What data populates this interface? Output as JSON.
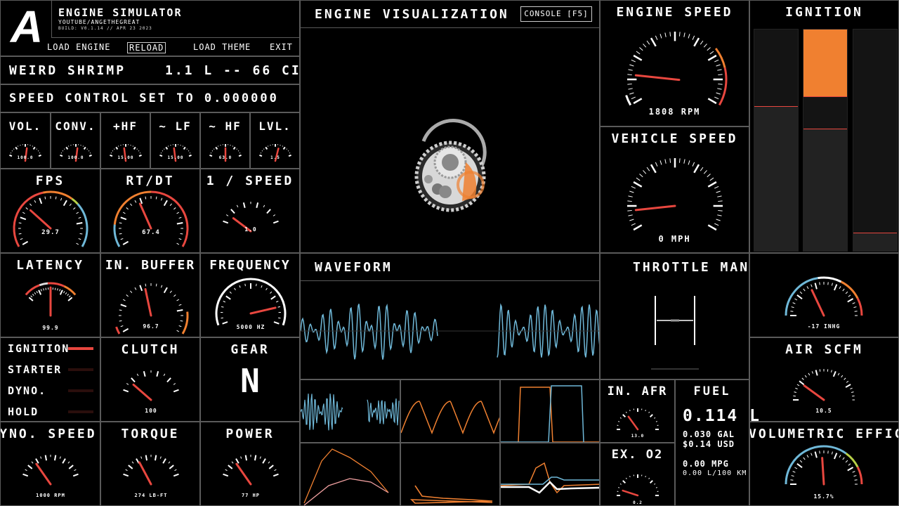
{
  "header": {
    "logo_letter": "A",
    "title": "ENGINE SIMULATOR",
    "subtitle": "YOUTUBE/ANGETHEGREAT",
    "build": "BUILD: V0.1.14 // APR 23 2023",
    "buttons": [
      "LOAD ENGINE",
      "RELOAD",
      "LOAD THEME",
      "EXIT"
    ]
  },
  "engine_name": "WEIRD SHRIMP",
  "engine_displacement": "1.1 L -- 66 CI",
  "speed_control": "SPEED CONTROL SET TO 0.000000",
  "visualization": {
    "title": "ENGINE VISUALIZATION",
    "console_button": "CONSOLE [F5]"
  },
  "colors": {
    "red": "#e8473f",
    "orange": "#f08030",
    "blue": "#6fb8d8",
    "white": "#ffffff",
    "green": "#b8d048"
  },
  "gauges": {
    "vol": {
      "title": "VOL.",
      "value": "100.0"
    },
    "conv": {
      "title": "CONV.",
      "value": "100.0"
    },
    "hf": {
      "title": "+HF",
      "value": "15.00"
    },
    "lf": {
      "title": "~ LF",
      "value": "15.00"
    },
    "hf2": {
      "title": "~ HF",
      "value": "63.0"
    },
    "lvl": {
      "title": "LVL.",
      "value": "1.5"
    },
    "fps": {
      "title": "FPS",
      "value": "29.7"
    },
    "rtdt": {
      "title": "RT/DT",
      "value": "67.4"
    },
    "speed_inv": {
      "title": "1 / SPEED",
      "value": "1.0"
    },
    "latency": {
      "title": "LATENCY",
      "value": "99.9"
    },
    "in_buffer": {
      "title": "IN. BUFFER",
      "value": "96.7"
    },
    "frequency": {
      "title": "FREQUENCY",
      "value": "5000 HZ"
    },
    "engine_speed": {
      "title": "ENGINE SPEED",
      "value": "1808 RPM"
    },
    "vehicle_speed": {
      "title": "VEHICLE SPEED",
      "value": "0 MPH"
    },
    "clutch": {
      "title": "CLUTCH",
      "value": "100"
    },
    "dyno_speed": {
      "title": "DYNO. SPEED",
      "value": "1000 RPM"
    },
    "torque": {
      "title": "TORQUE",
      "value": "274 LB-FT"
    },
    "power": {
      "title": "POWER",
      "value": "77 HP"
    },
    "manifold": {
      "title": "THROTTLE MANIFOLD PRESSURE",
      "value": "-17 INHG"
    },
    "air_scfm": {
      "title": "AIR SCFM",
      "value": "10.5"
    },
    "in_afr": {
      "title": "IN. AFR",
      "value": "13.0"
    },
    "ex_o2": {
      "title": "EX. O2",
      "value": "0.2"
    },
    "vol_eff": {
      "title": "VOLUMETRIC EFFICIENCY",
      "value": "15.7%"
    }
  },
  "ignition_panel": {
    "title": "IGNITION",
    "bar_levels": [
      0.65,
      0.55,
      0.08
    ]
  },
  "status_lights": [
    "IGNITION",
    "STARTER",
    "DYNO.",
    "HOLD"
  ],
  "gear": {
    "title": "GEAR",
    "value": "N"
  },
  "fuel": {
    "title": "FUEL",
    "main": "0.114 L",
    "gal": "0.030 GAL",
    "usd": "$0.14 USD",
    "mpg": "0.00 MPG",
    "l100": "0.00 L/100 KM"
  },
  "waveform": {
    "title": "WAVEFORM"
  }
}
